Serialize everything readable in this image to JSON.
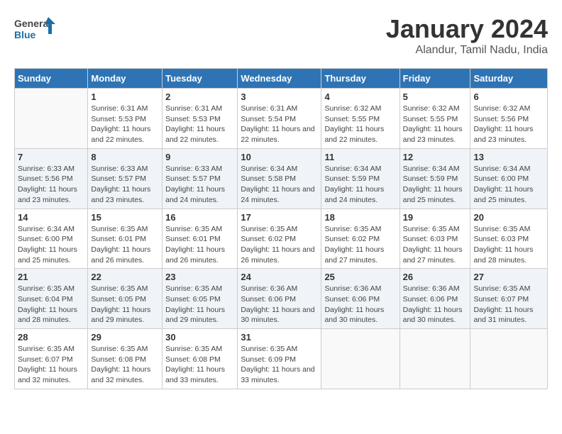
{
  "logo": {
    "line1": "General",
    "line2": "Blue"
  },
  "title": "January 2024",
  "subtitle": "Alandur, Tamil Nadu, India",
  "days_of_week": [
    "Sunday",
    "Monday",
    "Tuesday",
    "Wednesday",
    "Thursday",
    "Friday",
    "Saturday"
  ],
  "weeks": [
    [
      {
        "day": "",
        "sunrise": "",
        "sunset": "",
        "daylight": ""
      },
      {
        "day": "1",
        "sunrise": "Sunrise: 6:31 AM",
        "sunset": "Sunset: 5:53 PM",
        "daylight": "Daylight: 11 hours and 22 minutes."
      },
      {
        "day": "2",
        "sunrise": "Sunrise: 6:31 AM",
        "sunset": "Sunset: 5:53 PM",
        "daylight": "Daylight: 11 hours and 22 minutes."
      },
      {
        "day": "3",
        "sunrise": "Sunrise: 6:31 AM",
        "sunset": "Sunset: 5:54 PM",
        "daylight": "Daylight: 11 hours and 22 minutes."
      },
      {
        "day": "4",
        "sunrise": "Sunrise: 6:32 AM",
        "sunset": "Sunset: 5:55 PM",
        "daylight": "Daylight: 11 hours and 22 minutes."
      },
      {
        "day": "5",
        "sunrise": "Sunrise: 6:32 AM",
        "sunset": "Sunset: 5:55 PM",
        "daylight": "Daylight: 11 hours and 23 minutes."
      },
      {
        "day": "6",
        "sunrise": "Sunrise: 6:32 AM",
        "sunset": "Sunset: 5:56 PM",
        "daylight": "Daylight: 11 hours and 23 minutes."
      }
    ],
    [
      {
        "day": "7",
        "sunrise": "Sunrise: 6:33 AM",
        "sunset": "Sunset: 5:56 PM",
        "daylight": "Daylight: 11 hours and 23 minutes."
      },
      {
        "day": "8",
        "sunrise": "Sunrise: 6:33 AM",
        "sunset": "Sunset: 5:57 PM",
        "daylight": "Daylight: 11 hours and 23 minutes."
      },
      {
        "day": "9",
        "sunrise": "Sunrise: 6:33 AM",
        "sunset": "Sunset: 5:57 PM",
        "daylight": "Daylight: 11 hours and 24 minutes."
      },
      {
        "day": "10",
        "sunrise": "Sunrise: 6:34 AM",
        "sunset": "Sunset: 5:58 PM",
        "daylight": "Daylight: 11 hours and 24 minutes."
      },
      {
        "day": "11",
        "sunrise": "Sunrise: 6:34 AM",
        "sunset": "Sunset: 5:59 PM",
        "daylight": "Daylight: 11 hours and 24 minutes."
      },
      {
        "day": "12",
        "sunrise": "Sunrise: 6:34 AM",
        "sunset": "Sunset: 5:59 PM",
        "daylight": "Daylight: 11 hours and 25 minutes."
      },
      {
        "day": "13",
        "sunrise": "Sunrise: 6:34 AM",
        "sunset": "Sunset: 6:00 PM",
        "daylight": "Daylight: 11 hours and 25 minutes."
      }
    ],
    [
      {
        "day": "14",
        "sunrise": "Sunrise: 6:34 AM",
        "sunset": "Sunset: 6:00 PM",
        "daylight": "Daylight: 11 hours and 25 minutes."
      },
      {
        "day": "15",
        "sunrise": "Sunrise: 6:35 AM",
        "sunset": "Sunset: 6:01 PM",
        "daylight": "Daylight: 11 hours and 26 minutes."
      },
      {
        "day": "16",
        "sunrise": "Sunrise: 6:35 AM",
        "sunset": "Sunset: 6:01 PM",
        "daylight": "Daylight: 11 hours and 26 minutes."
      },
      {
        "day": "17",
        "sunrise": "Sunrise: 6:35 AM",
        "sunset": "Sunset: 6:02 PM",
        "daylight": "Daylight: 11 hours and 26 minutes."
      },
      {
        "day": "18",
        "sunrise": "Sunrise: 6:35 AM",
        "sunset": "Sunset: 6:02 PM",
        "daylight": "Daylight: 11 hours and 27 minutes."
      },
      {
        "day": "19",
        "sunrise": "Sunrise: 6:35 AM",
        "sunset": "Sunset: 6:03 PM",
        "daylight": "Daylight: 11 hours and 27 minutes."
      },
      {
        "day": "20",
        "sunrise": "Sunrise: 6:35 AM",
        "sunset": "Sunset: 6:03 PM",
        "daylight": "Daylight: 11 hours and 28 minutes."
      }
    ],
    [
      {
        "day": "21",
        "sunrise": "Sunrise: 6:35 AM",
        "sunset": "Sunset: 6:04 PM",
        "daylight": "Daylight: 11 hours and 28 minutes."
      },
      {
        "day": "22",
        "sunrise": "Sunrise: 6:35 AM",
        "sunset": "Sunset: 6:05 PM",
        "daylight": "Daylight: 11 hours and 29 minutes."
      },
      {
        "day": "23",
        "sunrise": "Sunrise: 6:35 AM",
        "sunset": "Sunset: 6:05 PM",
        "daylight": "Daylight: 11 hours and 29 minutes."
      },
      {
        "day": "24",
        "sunrise": "Sunrise: 6:36 AM",
        "sunset": "Sunset: 6:06 PM",
        "daylight": "Daylight: 11 hours and 30 minutes."
      },
      {
        "day": "25",
        "sunrise": "Sunrise: 6:36 AM",
        "sunset": "Sunset: 6:06 PM",
        "daylight": "Daylight: 11 hours and 30 minutes."
      },
      {
        "day": "26",
        "sunrise": "Sunrise: 6:36 AM",
        "sunset": "Sunset: 6:06 PM",
        "daylight": "Daylight: 11 hours and 30 minutes."
      },
      {
        "day": "27",
        "sunrise": "Sunrise: 6:35 AM",
        "sunset": "Sunset: 6:07 PM",
        "daylight": "Daylight: 11 hours and 31 minutes."
      }
    ],
    [
      {
        "day": "28",
        "sunrise": "Sunrise: 6:35 AM",
        "sunset": "Sunset: 6:07 PM",
        "daylight": "Daylight: 11 hours and 32 minutes."
      },
      {
        "day": "29",
        "sunrise": "Sunrise: 6:35 AM",
        "sunset": "Sunset: 6:08 PM",
        "daylight": "Daylight: 11 hours and 32 minutes."
      },
      {
        "day": "30",
        "sunrise": "Sunrise: 6:35 AM",
        "sunset": "Sunset: 6:08 PM",
        "daylight": "Daylight: 11 hours and 33 minutes."
      },
      {
        "day": "31",
        "sunrise": "Sunrise: 6:35 AM",
        "sunset": "Sunset: 6:09 PM",
        "daylight": "Daylight: 11 hours and 33 minutes."
      },
      {
        "day": "",
        "sunrise": "",
        "sunset": "",
        "daylight": ""
      },
      {
        "day": "",
        "sunrise": "",
        "sunset": "",
        "daylight": ""
      },
      {
        "day": "",
        "sunrise": "",
        "sunset": "",
        "daylight": ""
      }
    ]
  ]
}
